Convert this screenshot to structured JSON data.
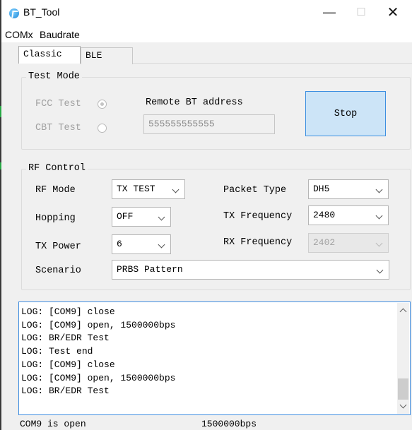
{
  "window": {
    "title": "BT_Tool",
    "minimize_glyph": "—",
    "maximize_glyph": "☐",
    "close_glyph": "✕"
  },
  "menu": [
    "COMx",
    "Baudrate"
  ],
  "tabs": [
    {
      "label": "Classic",
      "active": true
    },
    {
      "label": "BLE",
      "active": false
    }
  ],
  "test_mode": {
    "group_label": "Test Mode",
    "fcc_label": "FCC Test",
    "fcc_checked": true,
    "cbt_label": "CBT Test",
    "cbt_checked": false,
    "remote_label": "Remote BT address",
    "remote_value": "555555555555",
    "stop_label": "Stop"
  },
  "rf_control": {
    "group_label": "RF Control",
    "rf_mode_label": "RF Mode",
    "rf_mode_value": "TX TEST",
    "hopping_label": "Hopping",
    "hopping_value": "OFF",
    "tx_power_label": "TX Power",
    "tx_power_value": "6",
    "scenario_label": "Scenario",
    "scenario_value": "PRBS Pattern",
    "packet_type_label": "Packet Type",
    "packet_type_value": "DH5",
    "tx_freq_label": "TX Frequency",
    "tx_freq_value": "2480",
    "rx_freq_label": "RX Frequency",
    "rx_freq_value": "2402"
  },
  "log": [
    "LOG: [COM9] close",
    "LOG: [COM9] open, 1500000bps",
    "LOG: BR/EDR Test",
    "LOG: Test end",
    "LOG: [COM9] close",
    "LOG: [COM9] open, 1500000bps",
    "LOG: BR/EDR Test"
  ],
  "status": {
    "port": "COM9 is open",
    "baud": "1500000bps"
  },
  "colors": {
    "accent_border": "#3f8de0",
    "stop_button_fill": "#cce4f7",
    "window_bg": "#f0f0f0"
  },
  "icons": {
    "app": "bluetooth-app-icon",
    "combo_arrow": "chevron-down-icon"
  }
}
